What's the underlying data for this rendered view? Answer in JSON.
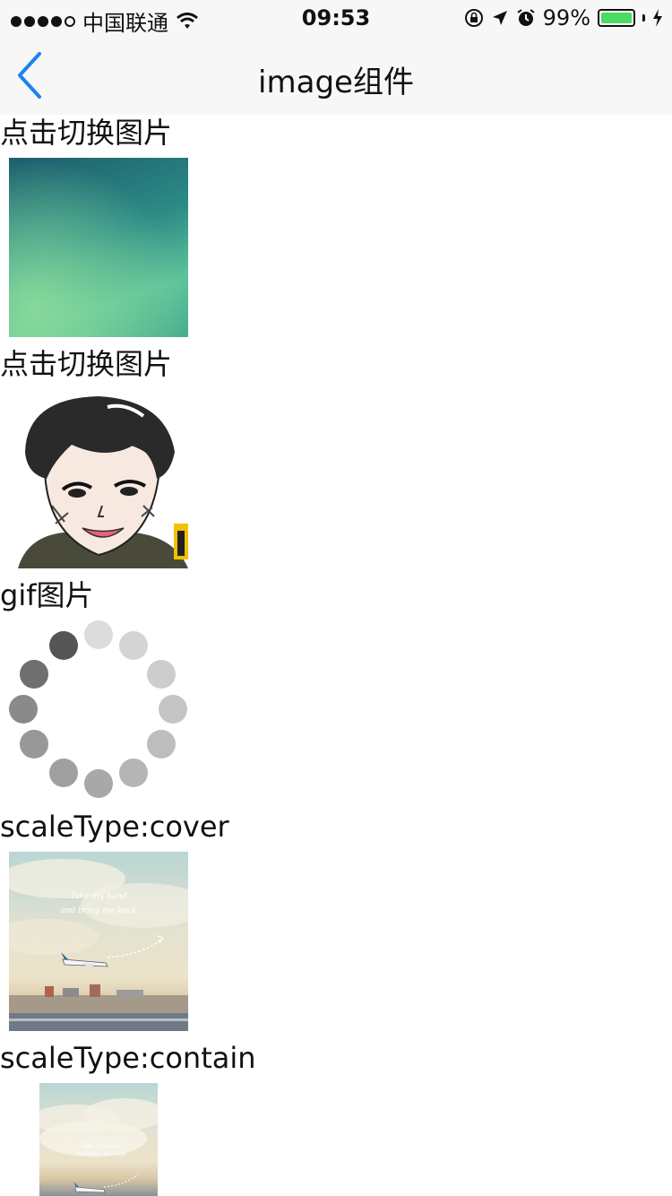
{
  "status_bar": {
    "carrier": "中国联通",
    "time": "09:53",
    "battery_percent": "99%",
    "signal_bars_filled": 4,
    "signal_bars_total": 5,
    "battery_level": 0.99,
    "battery_color": "#4cd964"
  },
  "nav": {
    "back_icon": "chevron-left-icon",
    "title": "image组件",
    "accent": "#1a84f0"
  },
  "sections": [
    {
      "label": "点击切换图片",
      "image": "green-gradient-image"
    },
    {
      "label": "点击切换图片",
      "image": "cartoon-boy-image"
    },
    {
      "label": "gif图片",
      "image": "loading-spinner-gif"
    },
    {
      "label": "scaleType:cover",
      "image": "airplane-sky-image-cover"
    },
    {
      "label": "scaleType:contain",
      "image": "airplane-sky-image-contain"
    }
  ],
  "photo_text": {
    "line1": "Take my hand",
    "line2": "and bring me back"
  }
}
